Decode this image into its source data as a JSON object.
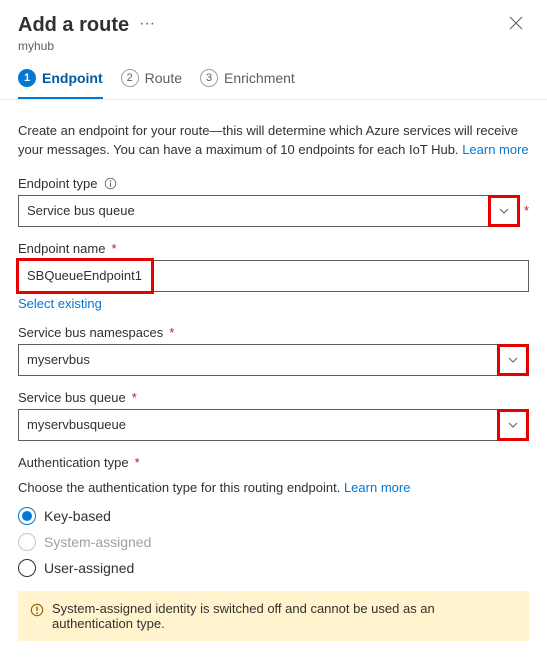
{
  "header": {
    "title": "Add a route",
    "subtitle": "myhub"
  },
  "tabs": [
    {
      "num": "1",
      "label": "Endpoint"
    },
    {
      "num": "2",
      "label": "Route"
    },
    {
      "num": "3",
      "label": "Enrichment"
    }
  ],
  "intro": {
    "text": "Create an endpoint for your route—this will determine which Azure services will receive your messages. You can have a maximum of 10 endpoints for each IoT Hub. ",
    "learn_more": "Learn more"
  },
  "endpoint_type": {
    "label": "Endpoint type",
    "value": "Service bus queue"
  },
  "endpoint_name": {
    "label": "Endpoint name",
    "value": "SBQueueEndpoint1",
    "select_existing": "Select existing"
  },
  "sb_namespace": {
    "label": "Service bus namespaces",
    "value": "myservbus"
  },
  "sb_queue": {
    "label": "Service bus queue",
    "value": "myservbusqueue"
  },
  "auth": {
    "label": "Authentication type",
    "desc": "Choose the authentication type for this routing endpoint. ",
    "learn_more": "Learn more",
    "options": {
      "key": "Key-based",
      "system": "System-assigned",
      "user": "User-assigned"
    }
  },
  "alert": "System-assigned identity is switched off and cannot be used as an authentication type.",
  "colors": {
    "link": "#0078d4",
    "req": "#a4262c",
    "hl": "#e60000",
    "warn_bg": "#fff4ce"
  }
}
